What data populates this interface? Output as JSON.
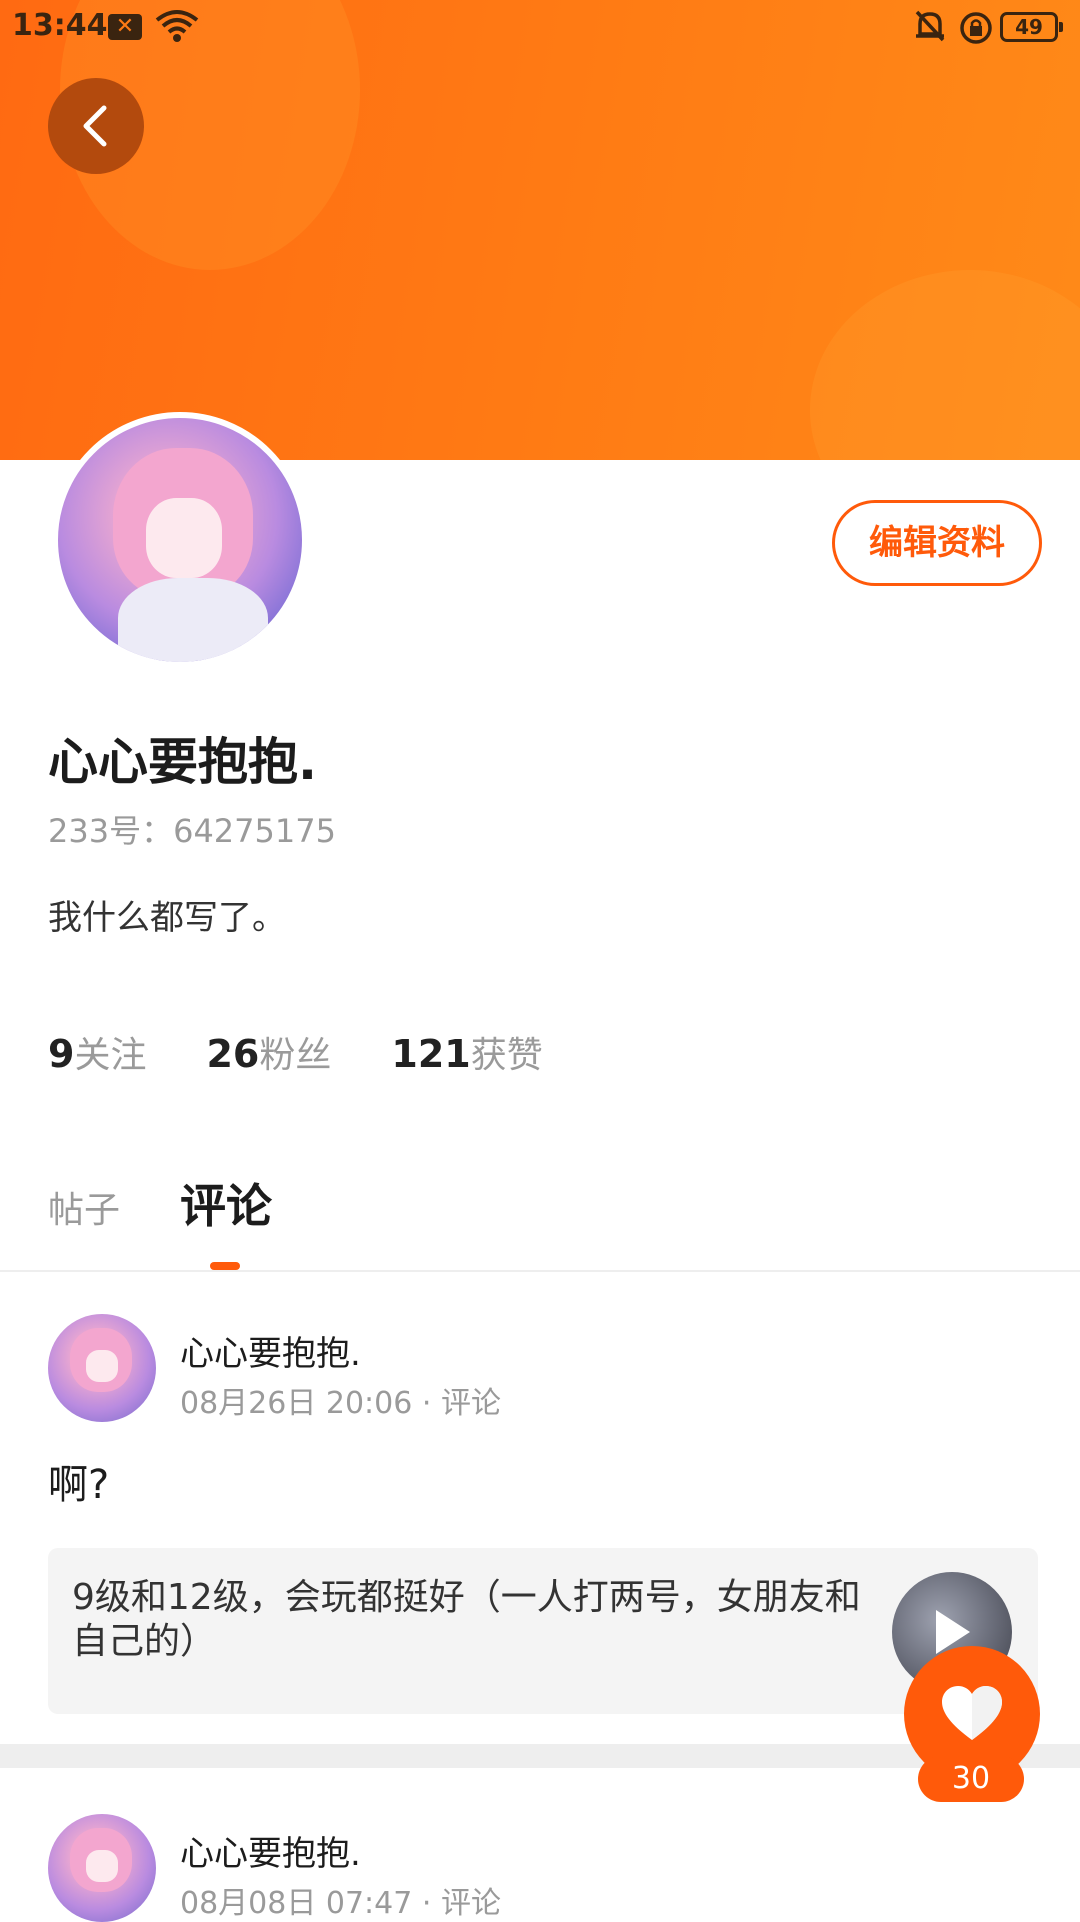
{
  "status_bar": {
    "time": "13:44",
    "notification_icon": "x-box-icon",
    "battery": "49"
  },
  "profile": {
    "nickname": "心心要抱抱.",
    "uid": "233号：64275175",
    "bio": "我什么都写了。",
    "edit_button": "编辑资料",
    "stats": [
      {
        "count": "9",
        "label": "关注"
      },
      {
        "count": "26",
        "label": "粉丝"
      },
      {
        "count": "121",
        "label": "获赞"
      }
    ]
  },
  "tabs": {
    "posts": "帖子",
    "comments": "评论",
    "active": "comments"
  },
  "feed": [
    {
      "author": "心心要抱抱.",
      "date": "08月26日 20:06",
      "type": "评论",
      "text": "啊?",
      "quote": "9级和12级，会玩都挺好（一人打两号，女朋友和自己的）"
    },
    {
      "author": "心心要抱抱.",
      "date": "08月08日 07:47",
      "type": "评论"
    }
  ],
  "like_button": {
    "count": "30"
  },
  "colors": {
    "accent": "#ff5a0a",
    "banner": "#ff7a14"
  }
}
